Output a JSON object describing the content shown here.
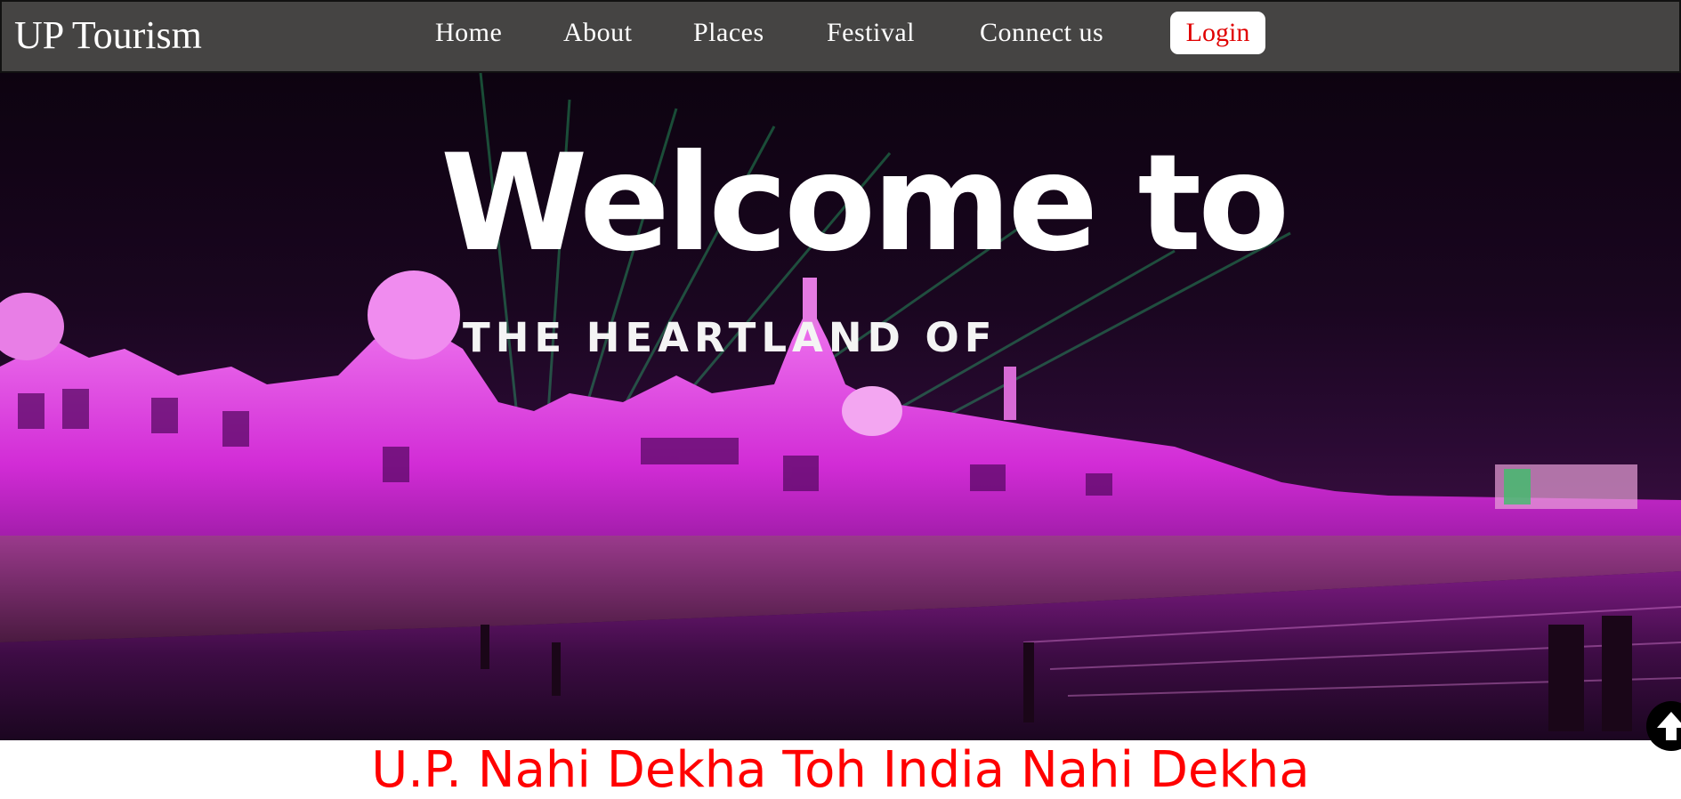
{
  "navbar": {
    "brand": "UP Tourism",
    "links": [
      {
        "label": "Home"
      },
      {
        "label": "About"
      },
      {
        "label": "Places"
      },
      {
        "label": "Festival"
      },
      {
        "label": "Connect us"
      }
    ],
    "login_label": "Login"
  },
  "hero": {
    "title": "Welcome to",
    "subtitle": "THE HEARTLAND OF"
  },
  "tagline": "U.P. Nahi Dekha Toh India Nahi Dekha",
  "icons": {
    "scroll_top": "arrow-up-icon"
  },
  "colors": {
    "navbar_bg": "#454443",
    "login_text": "#e00000",
    "tagline": "#ff0000",
    "hero_accent": "#e020e0"
  }
}
